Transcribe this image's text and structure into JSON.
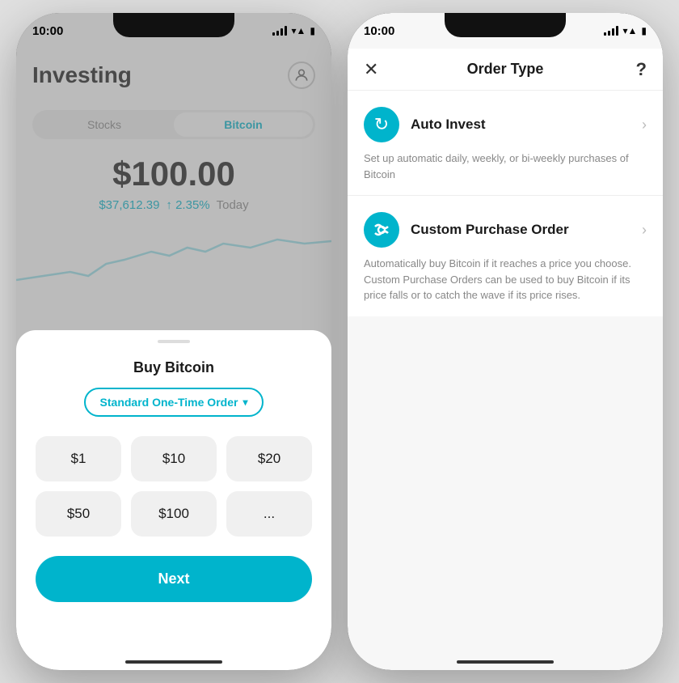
{
  "left_phone": {
    "status_time": "10:00",
    "title": "Investing",
    "tabs": [
      "Stocks",
      "Bitcoin"
    ],
    "active_tab": "Bitcoin",
    "main_price": "$100.00",
    "btc_price": "$37,612.39",
    "price_change": "↑ 2.35%",
    "price_period": "Today",
    "sheet": {
      "title": "Buy Bitcoin",
      "order_type": "Standard One-Time Order",
      "amounts": [
        "$1",
        "$10",
        "$20",
        "$50",
        "$100",
        "..."
      ],
      "next_btn": "Next"
    }
  },
  "right_phone": {
    "status_time": "10:00",
    "header": {
      "close": "✕",
      "title": "Order Type",
      "help": "?"
    },
    "options": [
      {
        "icon": "↻",
        "name": "Auto Invest",
        "desc": "Set up automatic daily, weekly, or bi-weekly purchases of Bitcoin"
      },
      {
        "icon": "⚡",
        "name": "Custom Purchase Order",
        "desc": "Automatically buy Bitcoin if it reaches a price you choose. Custom Purchase Orders can be used to buy Bitcoin if its price falls or to catch the wave if its price rises."
      }
    ]
  }
}
